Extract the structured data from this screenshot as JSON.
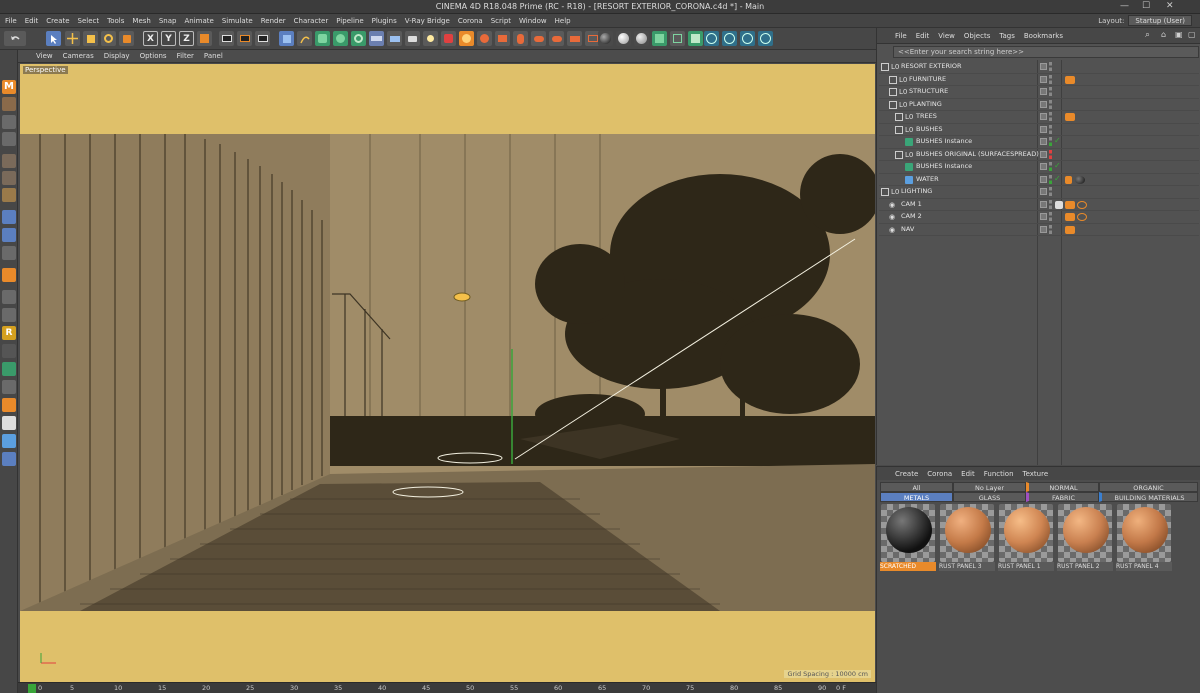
{
  "window": {
    "title": "CINEMA 4D R18.048 Prime (RC - R18) - [RESORT EXTERIOR_CORONA.c4d *] - Main",
    "min": "—",
    "max": "☐",
    "close": "✕"
  },
  "menubar": {
    "items": [
      "File",
      "Edit",
      "Create",
      "Select",
      "Tools",
      "Mesh",
      "Snap",
      "Animate",
      "Simulate",
      "Render",
      "Character",
      "Pipeline",
      "Plugins",
      "V-Ray Bridge",
      "Corona",
      "Script",
      "Window",
      "Help"
    ],
    "layout_label": "Layout:",
    "layout_value": "Startup (User)"
  },
  "toolbar": {
    "axis_x": "X",
    "axis_y": "Y",
    "axis_z": "Z"
  },
  "viewport": {
    "menu": [
      "View",
      "Cameras",
      "Display",
      "Options",
      "Filter",
      "Panel"
    ],
    "label": "Perspective",
    "grid_spacing": "Grid Spacing : 10000 cm"
  },
  "timeline": {
    "ticks": [
      "0",
      "5",
      "10",
      "15",
      "20",
      "25",
      "30",
      "35",
      "40",
      "45",
      "50",
      "55",
      "60",
      "65",
      "70",
      "75",
      "80",
      "85",
      "90"
    ],
    "end": "0 F"
  },
  "objects_panel": {
    "menu": [
      "File",
      "Edit",
      "View",
      "Objects",
      "Tags",
      "Bookmarks"
    ],
    "search_placeholder": "<<Enter your search string here>>",
    "objects": [
      {
        "name": "RESORT EXTERIOR",
        "depth": 0,
        "kind": "null"
      },
      {
        "name": "FURNITURE",
        "depth": 1,
        "kind": "null",
        "tag": "orange"
      },
      {
        "name": "STRUCTURE",
        "depth": 1,
        "kind": "null"
      },
      {
        "name": "PLANTING",
        "depth": 1,
        "kind": "null"
      },
      {
        "name": "TREES",
        "depth": 2,
        "kind": "null",
        "tag": "orange"
      },
      {
        "name": "BUSHES",
        "depth": 2,
        "kind": "null"
      },
      {
        "name": "BUSHES Instance",
        "depth": 2,
        "kind": "instance"
      },
      {
        "name": "BUSHES ORIGINAL (SURFACESPREAD)",
        "depth": 2,
        "kind": "null"
      },
      {
        "name": "BUSHES Instance",
        "depth": 2,
        "kind": "instance"
      },
      {
        "name": "WATER",
        "depth": 2,
        "kind": "plane",
        "tag": "material"
      },
      {
        "name": "LIGHTING",
        "depth": 0,
        "kind": "null"
      },
      {
        "name": "CAM 1",
        "depth": 0,
        "kind": "camera",
        "tag": "camera"
      },
      {
        "name": "CAM 2",
        "depth": 0,
        "kind": "camera",
        "tag": "camera"
      },
      {
        "name": "NAV",
        "depth": 0,
        "kind": "camera",
        "tag": "orange"
      }
    ]
  },
  "materials_panel": {
    "menu": [
      "Create",
      "Corona",
      "Edit",
      "Function",
      "Texture"
    ],
    "filters_row1": [
      "All",
      "No Layer",
      "NORMAL",
      "ORGANIC"
    ],
    "filters_row2": [
      "METALS",
      "GLASS",
      "FABRIC",
      "BUILDING MATERIALS"
    ],
    "materials": [
      {
        "name": "SCRATCHED",
        "color": "#2b2b2b",
        "selected": true
      },
      {
        "name": "RUST PANEL 3",
        "color": "#c47a48"
      },
      {
        "name": "RUST PANEL 1",
        "color": "#cf8552"
      },
      {
        "name": "RUST PANEL 2",
        "color": "#c98050"
      },
      {
        "name": "RUST PANEL 4",
        "color": "#c27848"
      }
    ]
  },
  "colors": {
    "viewport_bg": "#dfc06a",
    "scene": "#a08c68",
    "ui_dark": "#474747",
    "accent_orange": "#e98a2a"
  }
}
